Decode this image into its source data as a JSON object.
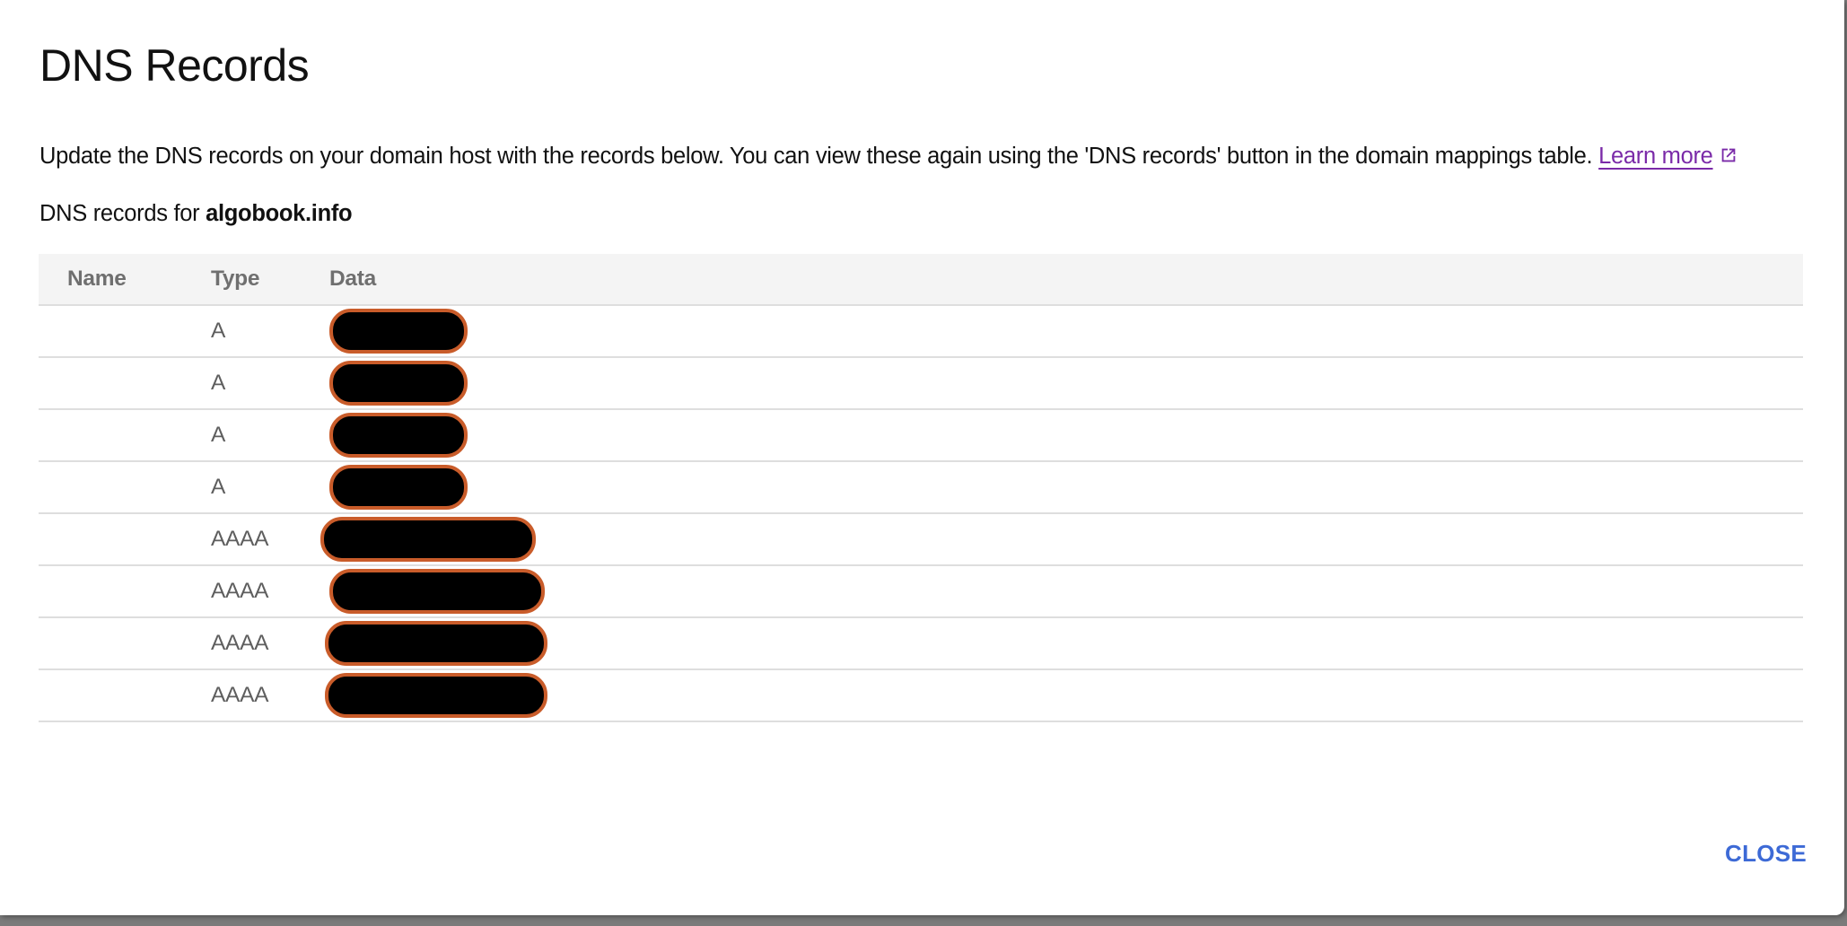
{
  "dialog": {
    "title": "DNS Records",
    "description": "Update the DNS records on your domain host with the records below. You can view these again using the 'DNS records' button in the domain mappings table.",
    "learn_more_label": "Learn more",
    "learn_more_icon": "external-link-icon",
    "subhead_prefix": "DNS records for ",
    "domain": "algobook.info",
    "close_label": "CLOSE"
  },
  "colors": {
    "link": "#7a2aa8",
    "primary_button": "#3d6ad6",
    "redaction_border": "#c95c2a"
  },
  "table": {
    "columns": [
      "Name",
      "Type",
      "Data"
    ],
    "rows": [
      {
        "name": "",
        "type": "A",
        "data": "[redacted]"
      },
      {
        "name": "",
        "type": "A",
        "data": "[redacted]"
      },
      {
        "name": "",
        "type": "A",
        "data": "[redacted]"
      },
      {
        "name": "",
        "type": "A",
        "data": "[redacted]"
      },
      {
        "name": "",
        "type": "AAAA",
        "data": "[redacted]"
      },
      {
        "name": "",
        "type": "AAAA",
        "data": "[redacted]"
      },
      {
        "name": "",
        "type": "AAAA",
        "data": "[redacted]"
      },
      {
        "name": "",
        "type": "AAAA",
        "data": "[redacted]"
      }
    ]
  }
}
